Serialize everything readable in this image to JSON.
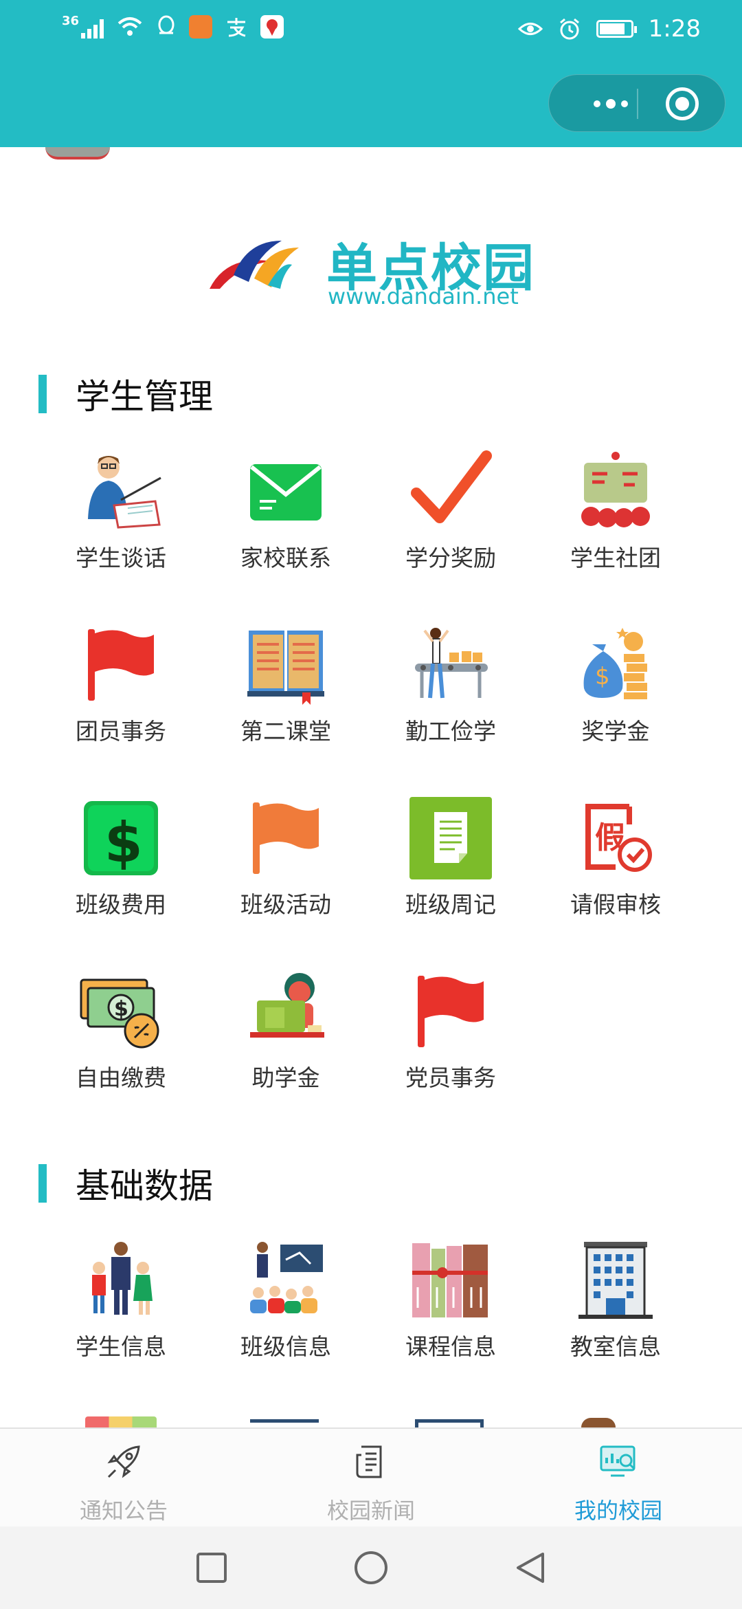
{
  "status_bar": {
    "network": "36",
    "time": "1:28"
  },
  "header": {
    "more_icon": "more-dots-icon",
    "close_icon": "target-close-icon"
  },
  "logo": {
    "name": "单点校园",
    "url": "www.dandain.net"
  },
  "sections": [
    {
      "title": "学生管理",
      "items": [
        {
          "label": "学生谈话",
          "icon": "teacher-talk-icon"
        },
        {
          "label": "家校联系",
          "icon": "envelope-icon"
        },
        {
          "label": "学分奖励",
          "icon": "checkmark-icon"
        },
        {
          "label": "学生社团",
          "icon": "club-board-icon"
        },
        {
          "label": "团员事务",
          "icon": "red-flag-icon"
        },
        {
          "label": "第二课堂",
          "icon": "open-book-icon"
        },
        {
          "label": "勤工俭学",
          "icon": "work-conveyor-icon"
        },
        {
          "label": "奖学金",
          "icon": "money-bag-icon"
        },
        {
          "label": "班级费用",
          "icon": "dollar-badge-icon"
        },
        {
          "label": "班级活动",
          "icon": "orange-flag-icon"
        },
        {
          "label": "班级周记",
          "icon": "document-icon"
        },
        {
          "label": "请假审核",
          "icon": "leave-approve-icon"
        },
        {
          "label": "自由缴费",
          "icon": "cash-coin-icon"
        },
        {
          "label": "助学金",
          "icon": "student-desk-icon"
        },
        {
          "label": "党员事务",
          "icon": "party-flag-icon"
        }
      ]
    },
    {
      "title": "基础数据",
      "items": [
        {
          "label": "学生信息",
          "icon": "students-group-icon"
        },
        {
          "label": "班级信息",
          "icon": "classroom-icon"
        },
        {
          "label": "课程信息",
          "icon": "books-icon"
        },
        {
          "label": "教室信息",
          "icon": "building-icon"
        }
      ]
    }
  ],
  "tabs": [
    {
      "label": "通知公告",
      "icon": "rocket-icon",
      "active": false
    },
    {
      "label": "校园新闻",
      "icon": "news-icon",
      "active": false
    },
    {
      "label": "我的校园",
      "icon": "campus-monitor-icon",
      "active": true
    }
  ],
  "colors": {
    "header": "#23bcc4",
    "accent": "#23bcc4",
    "tab_active": "#1f9bd7"
  }
}
